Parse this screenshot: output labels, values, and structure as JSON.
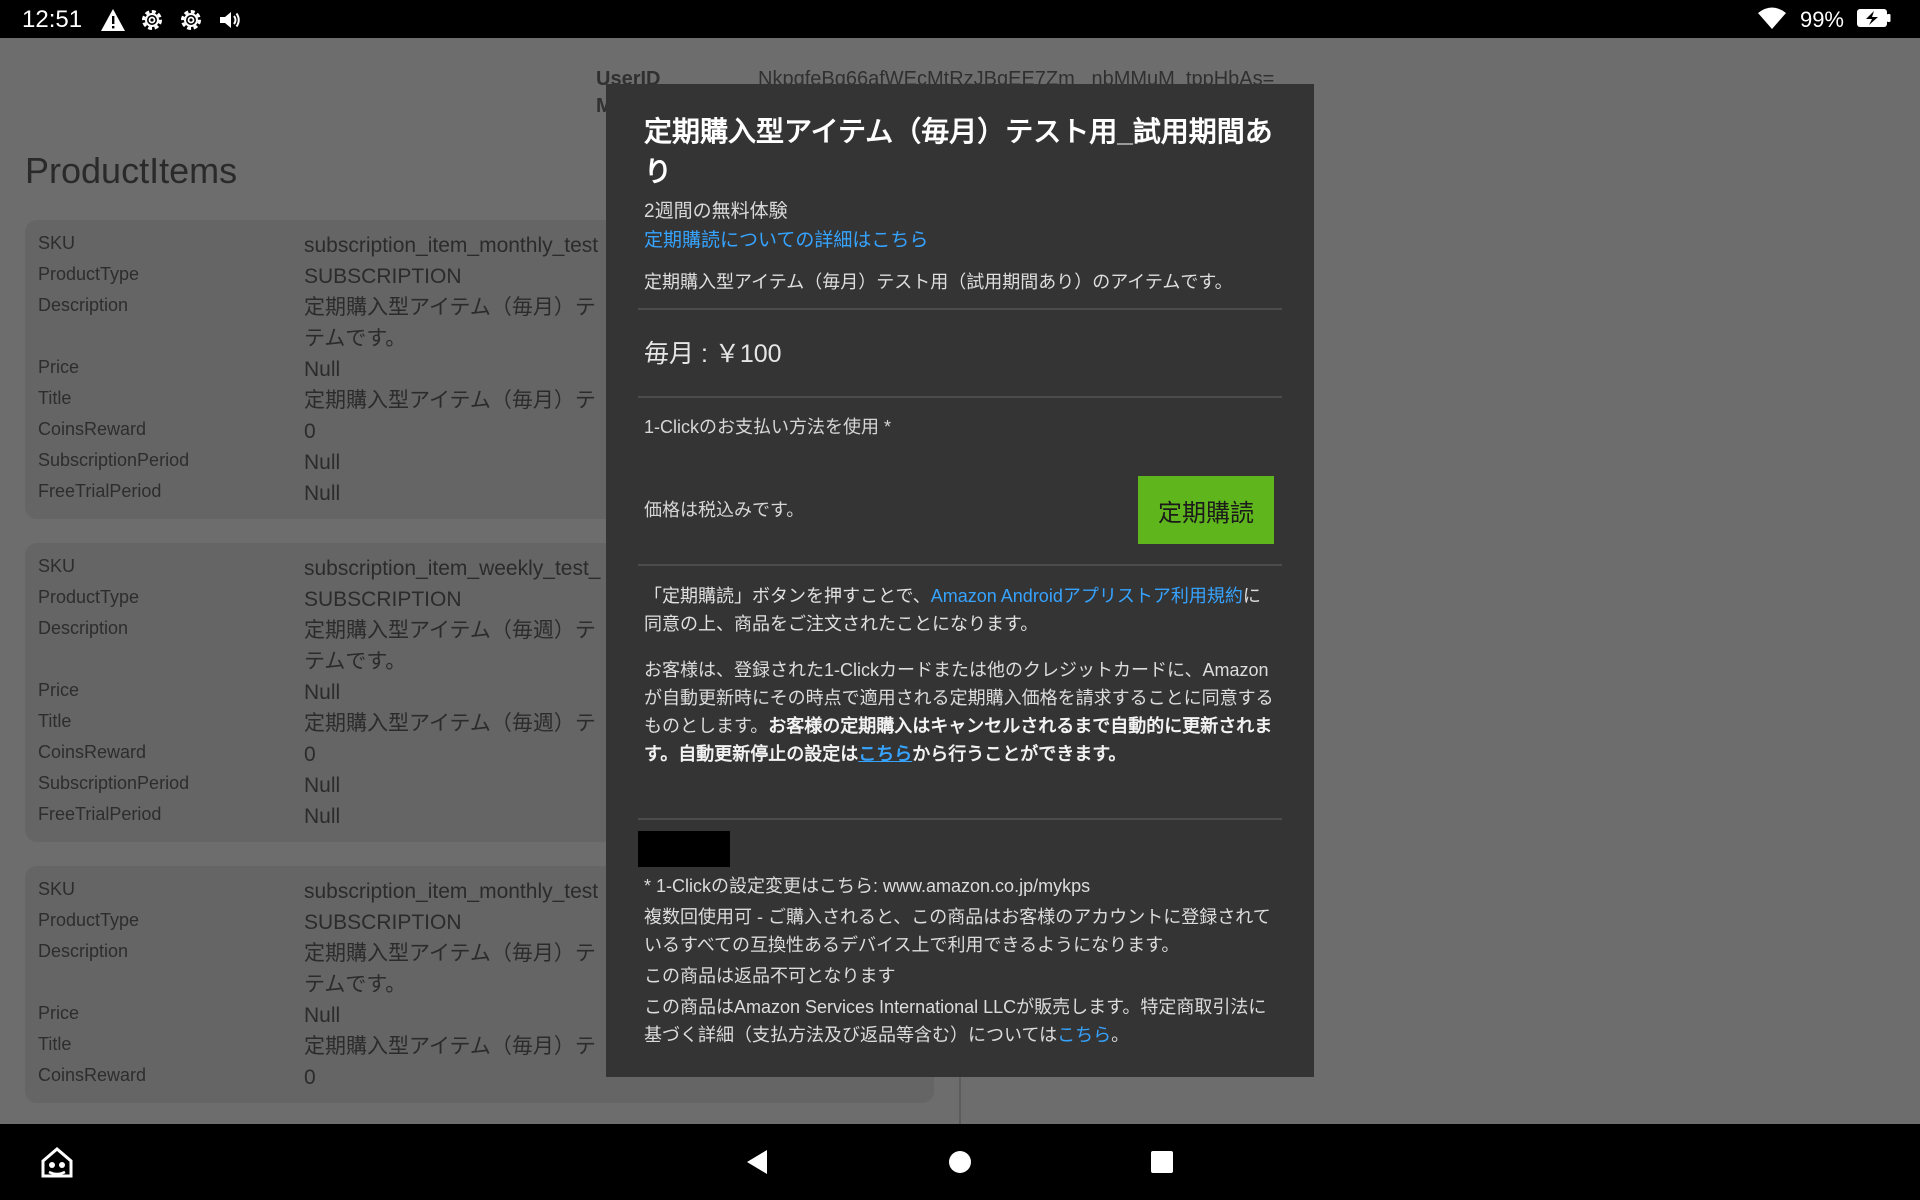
{
  "status_bar": {
    "time": "12:51",
    "icons": [
      "alert-icon",
      "settings-icon",
      "settings-icon",
      "volume-icon"
    ],
    "battery_pct": "99%"
  },
  "app": {
    "user": {
      "userid_label": "UserID",
      "userid_value": "NkpqfeBq66afWEcMtRzJBqEE7Zm_ nbMMuM_tppHbAs=",
      "m_label": "M"
    },
    "section_title": "ProductItems",
    "labels": {
      "sku": "SKU",
      "producttype": "ProductType",
      "description": "Description",
      "price": "Price",
      "title": "Title",
      "coinsreward": "CoinsReward",
      "subscriptionperiod": "SubscriptionPeriod",
      "freetrialperiod": "FreeTrialPeriod"
    },
    "cards": [
      {
        "sku": "subscription_item_monthly_test",
        "producttype": "SUBSCRIPTION",
        "description_l1": "定期購入型アイテム（毎月）テ",
        "description_l2": "テムです。",
        "price": "Null",
        "title": "定期購入型アイテム（毎月）テ",
        "coinsreward": "0",
        "subscriptionperiod": "Null",
        "freetrialperiod": "Null"
      },
      {
        "sku": "subscription_item_weekly_test_",
        "producttype": "SUBSCRIPTION",
        "description_l1": "定期購入型アイテム（毎週）テ",
        "description_l2": "テムです。",
        "price": "Null",
        "title": "定期購入型アイテム（毎週）テ",
        "coinsreward": "0",
        "subscriptionperiod": "Null",
        "freetrialperiod": "Null"
      },
      {
        "sku": "subscription_item_monthly_test",
        "producttype": "SUBSCRIPTION",
        "description_l1": "定期購入型アイテム（毎月）テ",
        "description_l2": "テムです。",
        "price": "Null",
        "title": "定期購入型アイテム（毎月）テ",
        "coinsreward": "0"
      }
    ]
  },
  "modal": {
    "title": "定期購入型アイテム（毎月）テスト用_試用期間あり",
    "trial": "2週間の無料体験",
    "details_link": "定期購読についての詳細はこちら",
    "description": "定期購入型アイテム（毎月）テスト用（試用期間あり）のアイテムです。",
    "price": "毎月 : ￥100",
    "payment": "1-Clickのお支払い方法を使用 *",
    "tax_note": "価格は税込みです。",
    "subscribe_button": "定期購読",
    "legal_prefix": "「定期購読」ボタンを押すことで、",
    "legal_link": "Amazon Androidアプリストア利用規約",
    "legal_suffix": "に同意の上、商品をご注文されたことになります。",
    "legal2_plain": "お客様は、登録された1-Clickカードまたは他のクレジットカードに、Amazonが自動更新時にその時点で適用される定期購入価格を請求することに同意するものとします。",
    "legal2_bold1": "お客様の定期購入はキャンセルされるまで自動的に更新されます。自動更新停止の設定は",
    "legal2_link": "こちら",
    "legal2_bold2": "から行うことができます。",
    "footer_1click": "* 1-Clickの設定変更はこちら: www.amazon.co.jp/mykps",
    "footer_multi": "複数回使用可 - ご購入されると、この商品はお客様のアカウントに登録されているすべての互換性あるデバイス上で利用できるようになります。",
    "footer_noreturn": "この商品は返品不可となります",
    "footer_seller_prefix": "この商品はAmazon Services International LLCが販売します。特定商取引法に基づく詳細（支払方法及び返品等含む）については",
    "footer_seller_link": "こちら",
    "footer_seller_suffix": "。"
  },
  "nav_bar": {
    "buttons": [
      "home-icon",
      "back-icon",
      "home-circle-icon",
      "recents-icon"
    ]
  }
}
